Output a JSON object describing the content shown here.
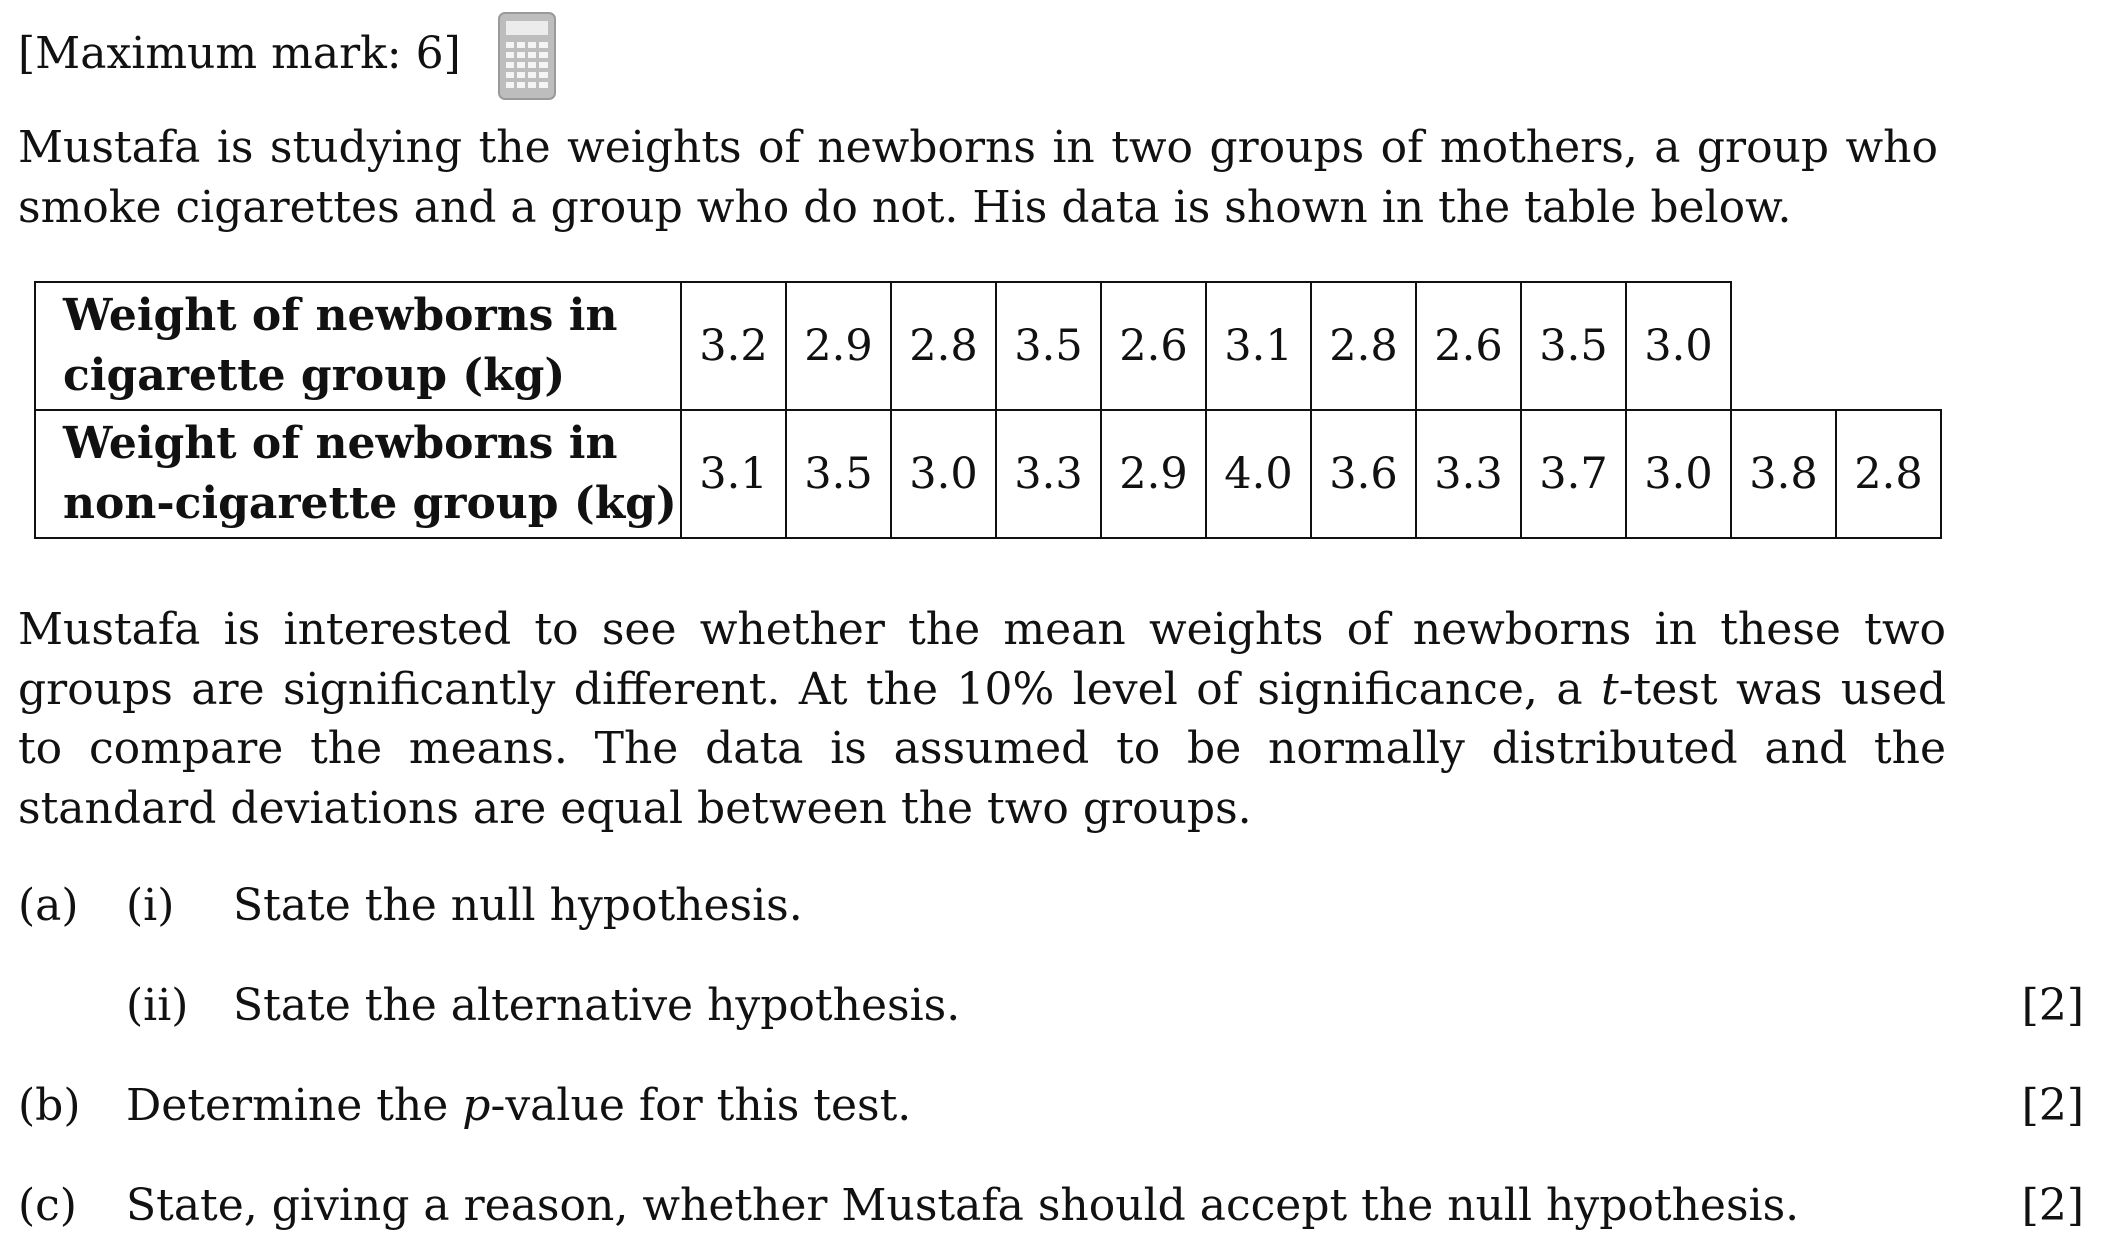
{
  "header": {
    "max_mark": "[Maximum mark: 6]",
    "calculator_icon": "calculator-icon"
  },
  "intro": "Mustafa is studying the weights of newborns in two groups of mothers, a group who smoke cigarettes and a group who do not. His data is shown in the table below.",
  "table": {
    "rows": [
      {
        "label_line1": "Weight of newborns in",
        "label_line2": "cigarette group (kg)",
        "values": [
          "3.2",
          "2.9",
          "2.8",
          "3.5",
          "2.6",
          "3.1",
          "2.8",
          "2.6",
          "3.5",
          "3.0"
        ]
      },
      {
        "label_line1": "Weight of newborns in",
        "label_line2": "non-cigarette group (kg)",
        "values": [
          "3.1",
          "3.5",
          "3.0",
          "3.3",
          "2.9",
          "4.0",
          "3.6",
          "3.3",
          "3.7",
          "3.0",
          "3.8",
          "2.8"
        ]
      }
    ]
  },
  "paragraph": {
    "part1": "Mustafa is interested to see whether the mean weights of newborns in these two groups are significantly different. At the 10% level of significance, a ",
    "t_var": "t",
    "part2": "-test was used to compare the means. The data is assumed to be normally distributed and the standard deviations are equal between the two groups."
  },
  "questions": {
    "a_label": "(a)",
    "a_i_label": "(i)",
    "a_i_text": "State the null hypothesis.",
    "a_ii_label": "(ii)",
    "a_ii_text": "State the alternative hypothesis.",
    "a_marks": "[2]",
    "b_label": "(b)",
    "b_text_pre": "Determine the ",
    "b_var": "p",
    "b_text_post": "-value for this test.",
    "b_marks": "[2]",
    "c_label": "(c)",
    "c_text": "State, giving a reason, whether Mustafa should accept the null hypothesis.",
    "c_marks": "[2]"
  }
}
